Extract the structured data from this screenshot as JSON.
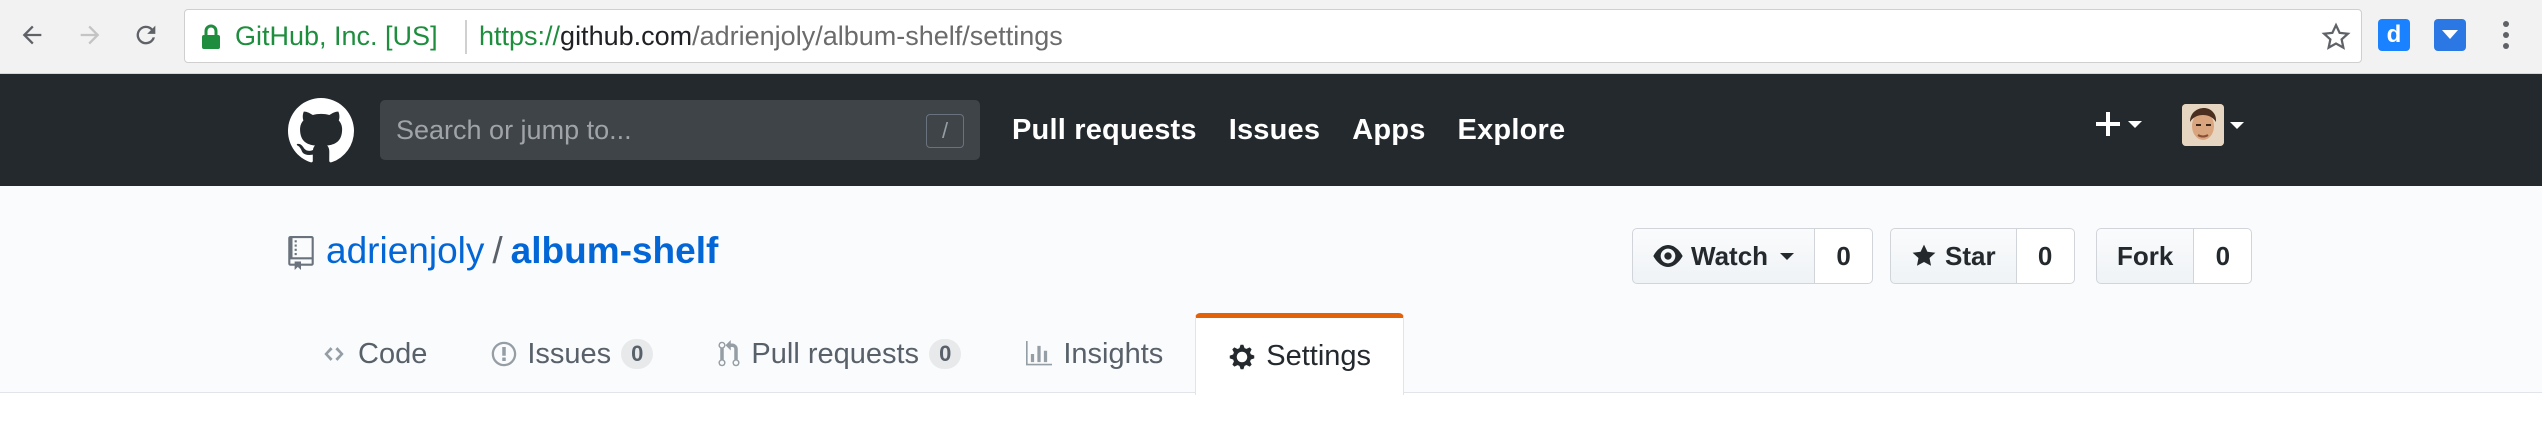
{
  "browser": {
    "secure_label": "GitHub, Inc. [US]",
    "url_scheme": "https://",
    "url_host": "github.com",
    "url_path": "/adrienjoly/album-shelf/settings",
    "extensions": [
      {
        "name": "d-extension-icon",
        "letter": "d",
        "color": "#1a82ff"
      },
      {
        "name": "pocket-extension-icon",
        "color": "#2b78e4"
      }
    ]
  },
  "header": {
    "search_placeholder": "Search or jump to...",
    "search_shortcut": "/",
    "nav": [
      "Pull requests",
      "Issues",
      "Apps",
      "Explore"
    ],
    "plus_symbol": "+"
  },
  "repo": {
    "owner": "adrienjoly",
    "separator": "/",
    "name": "album-shelf",
    "actions": {
      "watch": {
        "label": "Watch",
        "count": "0"
      },
      "star": {
        "label": "Star",
        "count": "0"
      },
      "fork": {
        "label": "Fork",
        "count": "0"
      }
    },
    "tabs": [
      {
        "label": "Code",
        "icon": "code-icon"
      },
      {
        "label": "Issues",
        "count": "0",
        "icon": "issue-icon"
      },
      {
        "label": "Pull requests",
        "count": "0",
        "icon": "pull-request-icon"
      },
      {
        "label": "Insights",
        "icon": "graph-icon"
      },
      {
        "label": "Settings",
        "icon": "gear-icon",
        "selected": true
      }
    ]
  },
  "colors": {
    "header_bg": "#24292e",
    "link_blue": "#0366d6",
    "selected_tab_accent": "#e36209",
    "secure_green": "#1e8e3e"
  }
}
